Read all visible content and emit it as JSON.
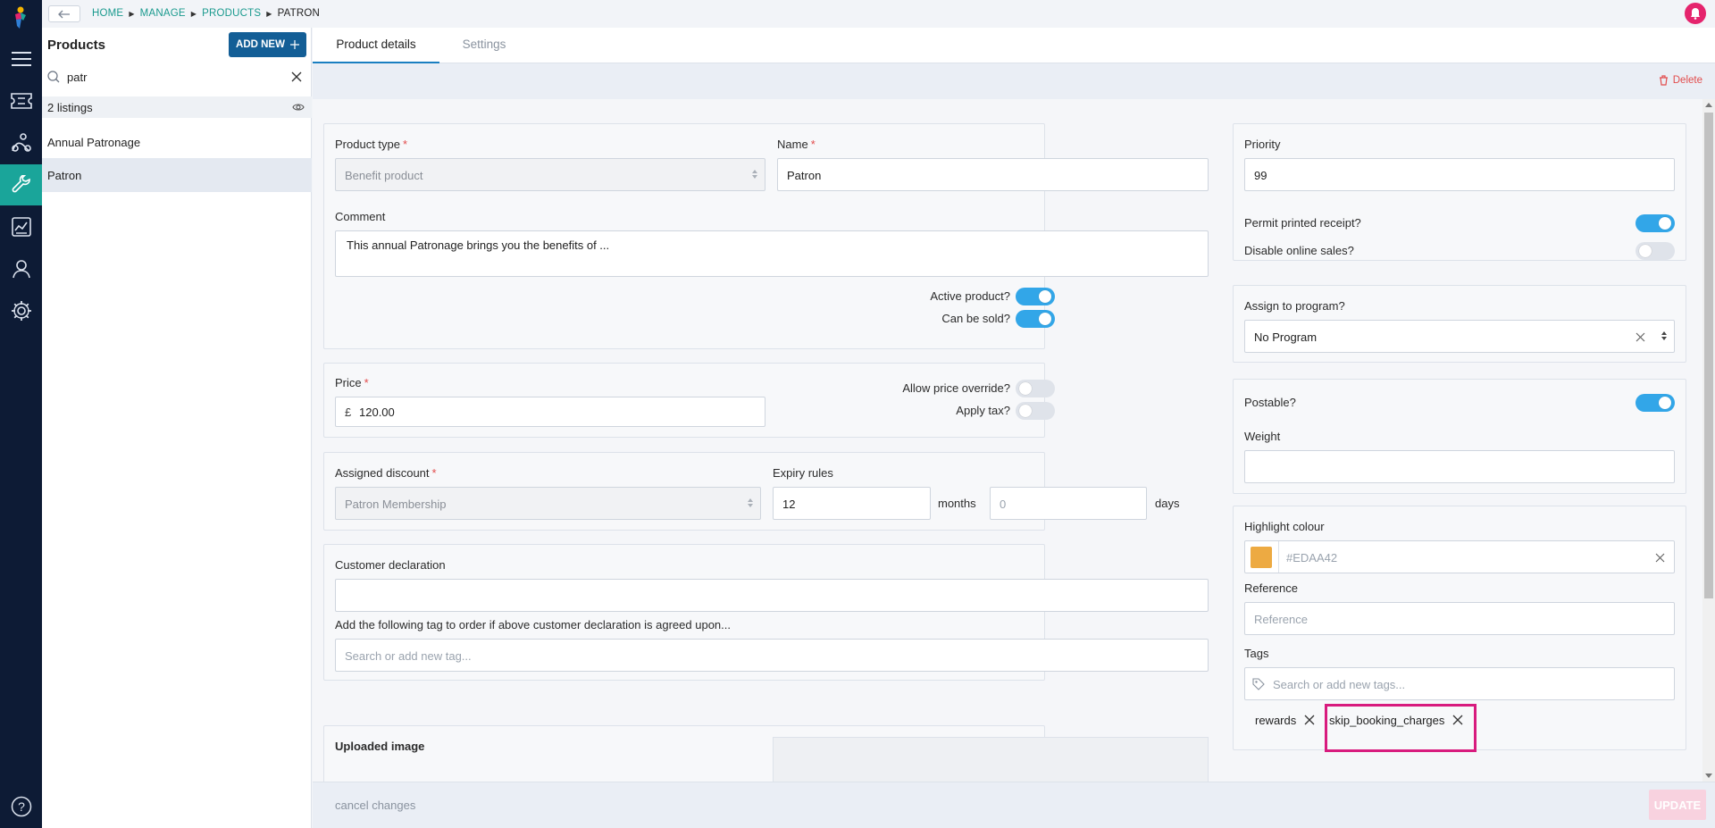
{
  "breadcrumbs": [
    "HOME",
    "MANAGE",
    "PRODUCTS",
    "PATRON"
  ],
  "sidebar_icons": [
    "menu-icon",
    "ticket-icon",
    "activity-icon",
    "wrench-icon",
    "report-icon",
    "user-icon",
    "settings-icon",
    "help-icon"
  ],
  "list": {
    "title": "Products",
    "add_new_label": "ADD NEW",
    "search_value": "patr",
    "count_label": "2 listings",
    "items": [
      "Annual Patronage",
      "Patron"
    ]
  },
  "tabs": [
    "Product details",
    "Settings"
  ],
  "actions": {
    "delete_label": "Delete"
  },
  "form": {
    "product_type_label": "Product type",
    "product_type_value": "Benefit product",
    "name_label": "Name",
    "name_value": "Patron",
    "comment_label": "Comment",
    "comment_value": "This annual Patronage brings you the benefits of ...",
    "active_label": "Active product?",
    "active_on": true,
    "can_sold_label": "Can be sold?",
    "can_sold_on": true,
    "price_label": "Price",
    "currency_symbol": "£",
    "price_value": "120.00",
    "allow_override_label": "Allow price override?",
    "allow_override_on": false,
    "apply_tax_label": "Apply tax?",
    "apply_tax_on": false,
    "assigned_discount_label": "Assigned discount",
    "assigned_discount_value": "Patron Membership",
    "expiry_rules_label": "Expiry rules",
    "expiry_months_value": "12",
    "months_label": "months",
    "expiry_days_placeholder": "0",
    "days_label": "days",
    "customer_declaration_label": "Customer declaration",
    "customer_declaration_value": "",
    "tag_on_agree_label": "Add the following tag to order if above customer declaration is agreed upon...",
    "tag_on_agree_placeholder": "Search or add new tag...",
    "uploaded_image_label": "Uploaded image"
  },
  "right": {
    "priority_label": "Priority",
    "priority_value": "99",
    "permit_receipt_label": "Permit printed receipt?",
    "permit_receipt_on": true,
    "disable_online_label": "Disable online sales?",
    "disable_online_on": false,
    "assign_program_label": "Assign to program?",
    "assign_program_value": "No Program",
    "postable_label": "Postable?",
    "postable_on": true,
    "weight_label": "Weight",
    "weight_value": "",
    "highlight_colour_label": "Highlight colour",
    "highlight_colour_value": "#EDAA42",
    "reference_label": "Reference",
    "reference_placeholder": "Reference",
    "tags_label": "Tags",
    "tags_placeholder": "Search or add new tags...",
    "tags": [
      "rewards",
      "skip_booking_charges"
    ]
  },
  "footer": {
    "cancel_label": "cancel changes",
    "update_label": "UPDATE"
  },
  "colors": {
    "rail": "#0d1b35",
    "rail_active": "#1aa59a",
    "accent": "#135e96",
    "toggle_on": "#32a6e8",
    "breadcrumb": "#1a9a8e",
    "highlight_outline": "#d81b7e",
    "notification": "#e5246d",
    "swatch": "#EDAA42"
  }
}
